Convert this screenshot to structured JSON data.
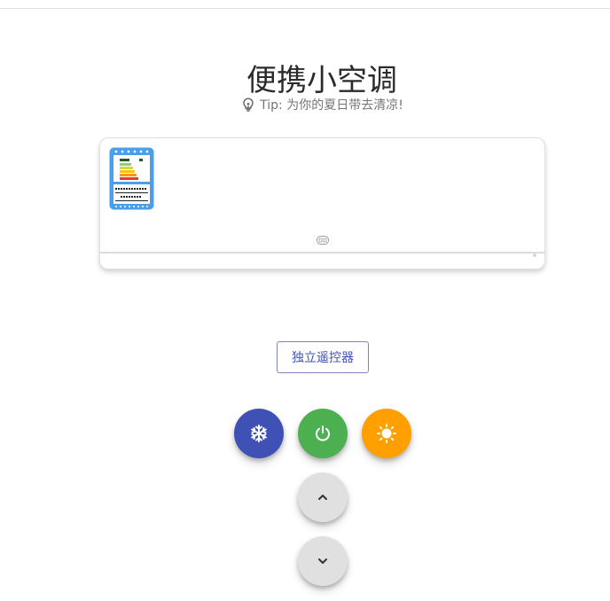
{
  "header": {
    "title": "便携小空调",
    "tip": "Tip: 为你的夏日带去清凉!"
  },
  "ac_unit": {
    "energy_label_icon": "energy-label-icon",
    "display_icon": "ac-display-icon"
  },
  "remote": {
    "label": "独立遥控器"
  },
  "controls": {
    "cool": {
      "icon": "snowflake-icon",
      "color": "#3f51b5"
    },
    "power": {
      "icon": "power-icon",
      "color": "#4caf50"
    },
    "heat": {
      "icon": "sun-icon",
      "color": "#ffa000"
    },
    "up": {
      "icon": "chevron-up-icon",
      "color": "#e0e0e0"
    },
    "down": {
      "icon": "chevron-down-icon",
      "color": "#e0e0e0"
    }
  },
  "tip_icon": "lightbulb-icon"
}
